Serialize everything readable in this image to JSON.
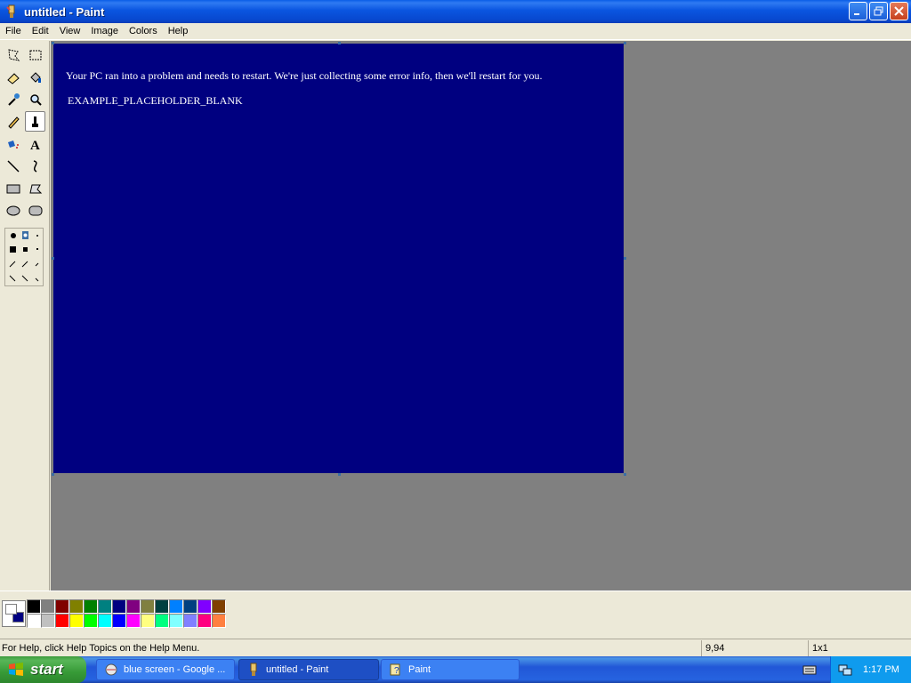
{
  "window": {
    "title": "untitled - Paint"
  },
  "menu": [
    "File",
    "Edit",
    "View",
    "Image",
    "Colors",
    "Help"
  ],
  "canvas": {
    "background": "#000080",
    "line1": "Your PC ran into a problem and needs to restart. We're just collecting some error info, then we'll restart for you.",
    "line2": "EXAMPLE_PLACEHOLDER_BLANK"
  },
  "tools": [
    "free-form-select",
    "select",
    "eraser",
    "fill",
    "pick-color",
    "magnifier",
    "pencil",
    "brush",
    "airbrush",
    "text",
    "line",
    "curve",
    "rectangle",
    "polygon",
    "ellipse",
    "rounded-rectangle"
  ],
  "palette": {
    "top": [
      "#000000",
      "#808080",
      "#800000",
      "#808000",
      "#008000",
      "#008080",
      "#000080",
      "#800080",
      "#808040",
      "#004040",
      "#0080ff",
      "#004080",
      "#8000ff",
      "#804000"
    ],
    "bottom": [
      "#ffffff",
      "#c0c0c0",
      "#ff0000",
      "#ffff00",
      "#00ff00",
      "#00ffff",
      "#0000ff",
      "#ff00ff",
      "#ffff80",
      "#00ff80",
      "#80ffff",
      "#8080ff",
      "#ff0080",
      "#ff8040"
    ]
  },
  "status": {
    "help": "For Help, click Help Topics on the Help Menu.",
    "coords": "9,94",
    "size": "1x1"
  },
  "taskbar": {
    "start": "start",
    "tasks": [
      "blue screen - Google ...",
      "untitled - Paint",
      "Paint"
    ],
    "clock": "1:17 PM"
  }
}
